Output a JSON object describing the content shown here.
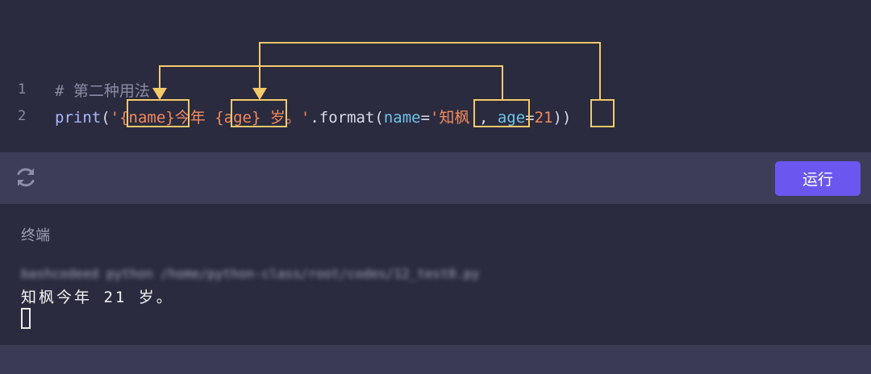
{
  "editor": {
    "line_numbers": [
      "1",
      "2"
    ],
    "line1_comment": "# 第二种用法",
    "line2": {
      "print": "print",
      "paren_open": "(",
      "quote_open": "'",
      "name_placeholder": "{name}",
      "text_jinnian": "今年 ",
      "age_placeholder": "{age}",
      "text_sui": " 岁。",
      "quote_close": "'",
      "format_call": ".format(",
      "kw_name": "name",
      "eq1": "=",
      "str_zhifeng": "'知枫'",
      "comma": ", ",
      "kw_age": "age",
      "eq2": "=",
      "num_21": "21",
      "closing": "))"
    }
  },
  "toolbar": {
    "refresh_icon": "refresh-icon",
    "run_label": "运行"
  },
  "terminal": {
    "title": "终端",
    "blurred_command": "bashcodeed python /home/python-class/root/codes/12_test0.py",
    "output_line": "知枫今年 21 岁。"
  },
  "colors": {
    "annotation": "#f3c969",
    "accent_button": "#6b57f0",
    "string": "#f08a5d",
    "identifier": "#6ec3e8"
  }
}
